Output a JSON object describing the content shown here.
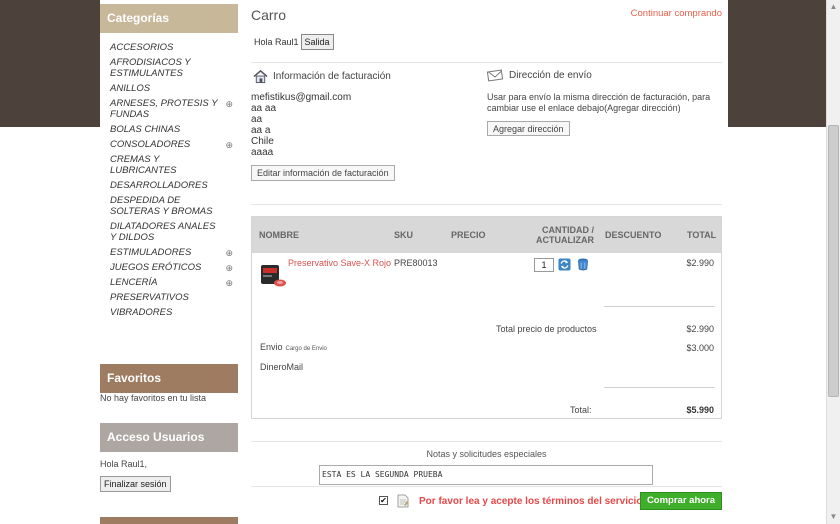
{
  "sidebar": {
    "categories_title": "Categorías",
    "categories": [
      {
        "label": "ACCESORIOS",
        "has_arrow": false
      },
      {
        "label": "AFRODISIACOS Y ESTIMULANTES",
        "has_arrow": false
      },
      {
        "label": "ANILLOS",
        "has_arrow": false
      },
      {
        "label": "ARNESES, PROTESIS Y FUNDAS",
        "has_arrow": true
      },
      {
        "label": "BOLAS CHINAS",
        "has_arrow": false
      },
      {
        "label": "CONSOLADORES",
        "has_arrow": true
      },
      {
        "label": "CREMAS Y LUBRICANTES",
        "has_arrow": false
      },
      {
        "label": "DESARROLLADORES",
        "has_arrow": false
      },
      {
        "label": "DESPEDIDA DE SOLTERAS Y BROMAS",
        "has_arrow": false
      },
      {
        "label": "DILATADORES ANALES Y DILDOS",
        "has_arrow": false
      },
      {
        "label": "ESTIMULADORES",
        "has_arrow": true
      },
      {
        "label": "JUEGOS ERÓTICOS",
        "has_arrow": true
      },
      {
        "label": "LENCERÍA",
        "has_arrow": true
      },
      {
        "label": "PRESERVATIVOS",
        "has_arrow": false
      },
      {
        "label": "VIBRADORES",
        "has_arrow": false
      }
    ],
    "favorites_title": "Favoritos",
    "favorites_empty": "No hay favoritos en tu lista",
    "access_title": "Acceso Usuarios",
    "access_hello": "Hola Raul1,",
    "logout_label": "Finalizar sesión"
  },
  "main": {
    "title": "Carro",
    "continue_link": "Continuar comprando",
    "hello": "Hola Raul1",
    "exit_label": "Salida",
    "billing": {
      "title": "Información de facturación",
      "lines": [
        "mefistikus@gmail.com",
        "aa aa",
        "aa",
        "aa a",
        "Chile",
        "aaaa"
      ],
      "edit_label": "Editar información de facturación"
    },
    "shipping": {
      "title": "Dirección de envío",
      "description": "Usar para envío la misma dirección de facturación, para cambiar use el enlace debajo(Agregar dirección)",
      "add_label": "Agregar dirección"
    }
  },
  "cart_table": {
    "headers": {
      "name": "NOMBRE",
      "sku": "SKU",
      "price": "PRECIO",
      "qty_line1": "CANTIDAD /",
      "qty_line2": "ACTUALIZAR",
      "discount": "DESCUENTO",
      "total": "TOTAL"
    },
    "item": {
      "name": "Preservativo Save-X Rojo",
      "sku": "PRE80013",
      "quantity": "1",
      "total": "$2.990"
    },
    "products_total_label": "Total precio de productos",
    "products_total_value": "$2.990",
    "shipping_label": "Envio",
    "shipping_sub": "Cargo de Envio",
    "shipping_value": "$3.000",
    "payment_method": "DineroMail",
    "grand_total_label": "Total:",
    "grand_total_value": "$5.990"
  },
  "footer": {
    "notes_label": "Notas y solicitudes especiales",
    "notes_value": "ESTA ES LA SEGUNDA PRUEBA",
    "terms_text": "Por favor lea y acepte los términos del servicio.",
    "terms_checked": true,
    "buy_label": "Comprar ahora"
  },
  "colors": {
    "dark_band": "#4c413b",
    "categories_header": "#c8b89a",
    "favorites_header": "#9e7c61",
    "access_header": "#aea6a2",
    "link_red": "#e8604c",
    "buy_green": "#3fae2a"
  }
}
